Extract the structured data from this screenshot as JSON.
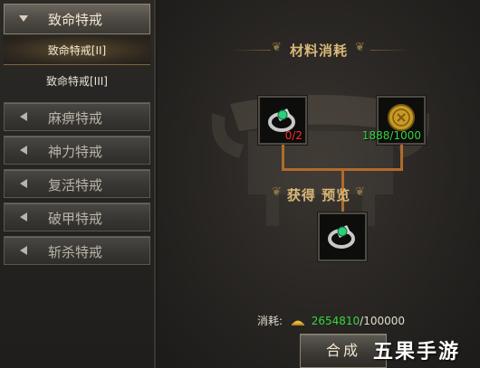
{
  "sidebar": {
    "expanded": {
      "label": "致命特戒"
    },
    "subitems": [
      {
        "label": "致命特戒[II]",
        "active": true
      },
      {
        "label": "致命特戒[III]",
        "active": false
      }
    ],
    "categories": [
      {
        "label": "麻痹特戒"
      },
      {
        "label": "神力特戒"
      },
      {
        "label": "复活特戒"
      },
      {
        "label": "破甲特戒"
      },
      {
        "label": "斩杀特戒"
      }
    ]
  },
  "materials": {
    "title": "材料消耗",
    "items": [
      {
        "icon": "jade-ring-icon",
        "count": "0/2",
        "count_color": "#ff3030"
      },
      {
        "icon": "gold-coin-icon",
        "count": "1888/1000",
        "count_color": "#38d640"
      }
    ]
  },
  "preview": {
    "title": "获得  预览",
    "result_icon": "jade-ring-icon"
  },
  "cost": {
    "label": "消耗:",
    "have": "2654810",
    "need": "/100000"
  },
  "synthesize_label": "合成",
  "watermark": "五果手游"
}
